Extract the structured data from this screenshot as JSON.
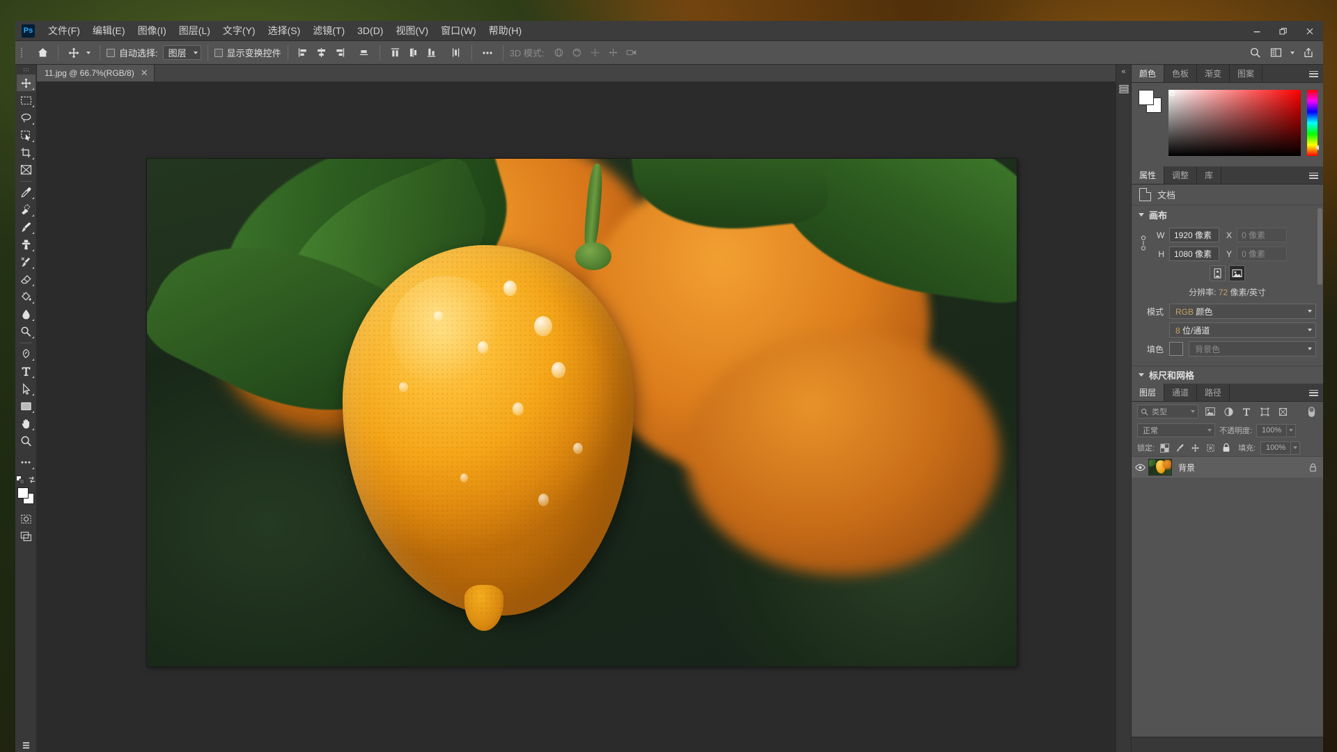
{
  "app": {
    "name": "Ps",
    "logo_text": "Ps"
  },
  "menubar": {
    "items": [
      {
        "label": "文件(F)",
        "name": "menu-file"
      },
      {
        "label": "编辑(E)",
        "name": "menu-edit"
      },
      {
        "label": "图像(I)",
        "name": "menu-image"
      },
      {
        "label": "图层(L)",
        "name": "menu-layer"
      },
      {
        "label": "文字(Y)",
        "name": "menu-type"
      },
      {
        "label": "选择(S)",
        "name": "menu-select"
      },
      {
        "label": "滤镜(T)",
        "name": "menu-filter"
      },
      {
        "label": "3D(D)",
        "name": "menu-3d"
      },
      {
        "label": "视图(V)",
        "name": "menu-view"
      },
      {
        "label": "窗口(W)",
        "name": "menu-window"
      },
      {
        "label": "帮助(H)",
        "name": "menu-help"
      }
    ],
    "window_controls": {
      "minimize": "–",
      "restore": "❐",
      "close": "✕"
    }
  },
  "options_bar": {
    "home_icon": "home-icon",
    "tool_icon": "move-tool-icon",
    "auto_select_label": "自动选择:",
    "auto_select_value": "图层",
    "show_transform_label": "显示变换控件",
    "more_label": "•••",
    "mode_3d_label": "3D 模式:",
    "align_icons": [
      "align-left-icon",
      "align-center-horizontal-icon",
      "align-right-icon",
      "align-top-edges-icon"
    ],
    "distribute_icons": [
      "distribute-top-icon",
      "distribute-center-vertical-icon",
      "distribute-bottom-icon",
      "distribute-horizontal-icon"
    ],
    "mode3d_icons": [
      "orbit-3d-icon",
      "roll-3d-icon",
      "pan-3d-icon",
      "slide-3d-icon",
      "zoom-3d-icon"
    ],
    "right_icons": [
      "search-icon",
      "arrange-documents-icon",
      "share-icon"
    ]
  },
  "toolbar": {
    "tools": [
      {
        "name": "move-tool",
        "icon": "move-icon",
        "active": true,
        "corner": true
      },
      {
        "name": "marquee-tool",
        "icon": "rectangular-marquee-icon",
        "corner": true
      },
      {
        "name": "lasso-tool",
        "icon": "lasso-icon",
        "corner": true
      },
      {
        "name": "quick-select-tool",
        "icon": "object-selection-icon",
        "corner": true
      },
      {
        "name": "crop-tool",
        "icon": "crop-icon",
        "corner": true
      },
      {
        "name": "frame-tool",
        "icon": "frame-icon",
        "corner": false
      },
      {
        "name": "eyedropper-tool",
        "icon": "eyedropper-icon",
        "corner": true
      },
      {
        "name": "spot-healing-tool",
        "icon": "spot-healing-brush-icon",
        "corner": true
      },
      {
        "name": "brush-tool",
        "icon": "brush-icon",
        "corner": true
      },
      {
        "name": "clone-stamp-tool",
        "icon": "clone-stamp-icon",
        "corner": true
      },
      {
        "name": "history-brush-tool",
        "icon": "history-brush-icon",
        "corner": true
      },
      {
        "name": "eraser-tool",
        "icon": "eraser-icon",
        "corner": true
      },
      {
        "name": "gradient-tool",
        "icon": "paint-bucket-icon",
        "corner": true
      },
      {
        "name": "blur-tool",
        "icon": "blur-drop-icon",
        "corner": true
      },
      {
        "name": "dodge-tool",
        "icon": "dodge-icon",
        "corner": true
      },
      {
        "name": "pen-tool",
        "icon": "pen-icon",
        "corner": true
      },
      {
        "name": "type-tool",
        "icon": "type-t-icon",
        "corner": true
      },
      {
        "name": "path-selection-tool",
        "icon": "path-selection-arrow-icon",
        "corner": true
      },
      {
        "name": "shape-tool",
        "icon": "rectangle-shape-icon",
        "corner": true
      },
      {
        "name": "hand-tool",
        "icon": "hand-icon",
        "corner": true
      },
      {
        "name": "zoom-tool",
        "icon": "zoom-magnifier-icon",
        "corner": false
      },
      {
        "name": "edit-toolbar",
        "icon": "ellipsis-icon",
        "corner": true
      }
    ],
    "default_colors_icon": "default-colors-icon",
    "swap_colors_icon": "swap-colors-icon",
    "foreground_color": "#ffffff",
    "background_color": "#ffffff",
    "quickmask_icon": "quick-mask-icon",
    "screenmode_icon": "screen-mode-icon"
  },
  "document": {
    "tab_title": "11.jpg @ 66.7%(RGB/8)",
    "close_icon": "close-icon"
  },
  "color_panel": {
    "tabs": [
      {
        "label": "颜色",
        "active": true
      },
      {
        "label": "色板",
        "active": false
      },
      {
        "label": "渐变",
        "active": false
      },
      {
        "label": "图案",
        "active": false
      }
    ],
    "menu_icon": "panel-menu-icon",
    "foreground": "#ffffff",
    "background": "#ffffff"
  },
  "properties_panel": {
    "tabs": [
      {
        "label": "属性",
        "active": true
      },
      {
        "label": "调整",
        "active": false
      },
      {
        "label": "库",
        "active": false
      }
    ],
    "menu_icon": "panel-menu-icon",
    "doc_row_label": "文档",
    "doc_icon": "document-icon",
    "canvas_section": {
      "title": "画布",
      "width_label": "W",
      "width_value": "1920 像素",
      "height_label": "H",
      "height_value": "1080 像素",
      "x_label": "X",
      "x_value": "0 像素",
      "y_label": "Y",
      "y_value": "0 像素",
      "link_icon": "link-chain-icon",
      "portrait_icon": "portrait-orientation-icon",
      "landscape_icon": "landscape-orientation-icon",
      "resolution_label": "分辨率:",
      "resolution_value": "72",
      "resolution_unit": "像素/英寸",
      "mode_label": "模式",
      "mode_prefix": "RGB",
      "mode_value": "颜色",
      "depth_prefix": "8",
      "depth_value": "位/通道",
      "fill_label": "填色",
      "fill_value": "背景色"
    },
    "rulers_section": {
      "title": "标尺和网格"
    }
  },
  "layers_panel": {
    "tabs": [
      {
        "label": "图层",
        "active": true
      },
      {
        "label": "通道",
        "active": false
      },
      {
        "label": "路径",
        "active": false
      }
    ],
    "menu_icon": "panel-menu-icon",
    "filter_placeholder": "类型",
    "filter_icons": [
      "filter-pixel-icon",
      "filter-adjustment-icon",
      "filter-type-icon",
      "filter-shape-icon",
      "filter-smart-object-icon"
    ],
    "filter_toggle_icon": "filter-toggle-icon",
    "blend_mode": "正常",
    "opacity_label": "不透明度:",
    "opacity_value": "100%",
    "lock_label": "锁定:",
    "lock_icons": [
      "lock-transparent-pixels-icon",
      "lock-image-pixels-icon",
      "lock-position-icon",
      "lock-artboard-icon",
      "lock-all-icon"
    ],
    "fill_label": "填充:",
    "fill_value": "100%",
    "layers": [
      {
        "name": "背景",
        "visible": true,
        "locked": true,
        "eye_icon": "eye-icon",
        "lock_icon": "lock-icon"
      }
    ]
  },
  "colors": {
    "accent": "#31a8ff",
    "panel_bg": "#535353",
    "window_bg": "#323232",
    "canvas_bg": "#2b2b2b",
    "toolbar_bg": "#383838"
  }
}
